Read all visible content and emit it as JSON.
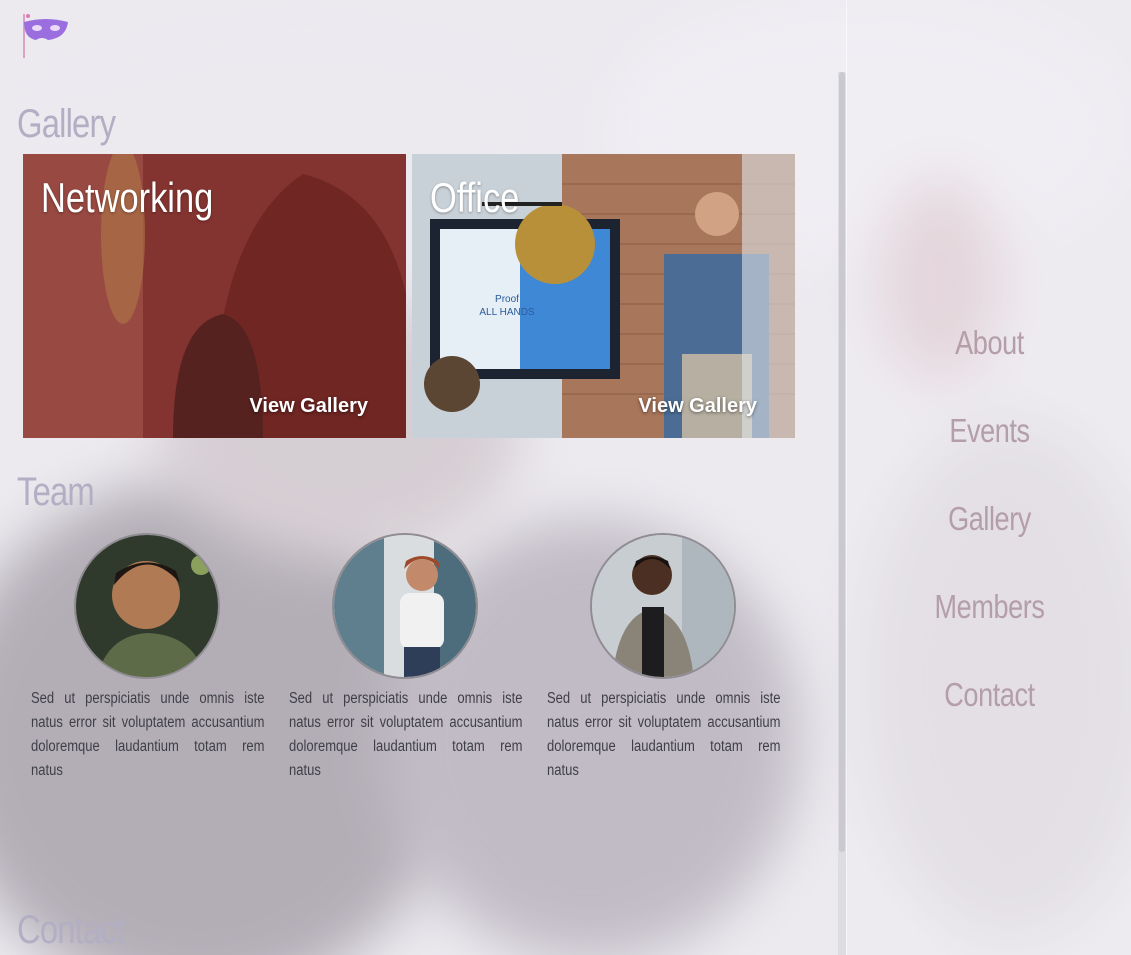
{
  "sections": {
    "gallery_title": "Gallery",
    "team_title": "Team",
    "contact_title": "Contact"
  },
  "gallery": {
    "cards": [
      {
        "title": "Networking",
        "link": "View Gallery"
      },
      {
        "title": "Office",
        "link": "View Gallery"
      }
    ]
  },
  "team": {
    "members": [
      {
        "text": "Sed ut perspiciatis unde omnis iste natus error sit voluptatem accusantium doloremque laudantium totam rem natus"
      },
      {
        "text": "Sed ut perspiciatis unde omnis iste natus error sit voluptatem accusantium doloremque laudantium totam rem natus"
      },
      {
        "text": "Sed ut perspiciatis unde omnis iste natus error sit voluptatem accusantium doloremque laudantium totam rem natus"
      }
    ]
  },
  "nav": {
    "items": [
      {
        "label": "About"
      },
      {
        "label": "Events"
      },
      {
        "label": "Gallery"
      },
      {
        "label": "Members"
      },
      {
        "label": "Contact"
      }
    ]
  },
  "colors": {
    "section_title": "#b2aec4",
    "nav_text": "#b49ea7",
    "logo_mask": "#9b6ee0"
  },
  "icons": {
    "logo": "mask-flag-icon"
  }
}
